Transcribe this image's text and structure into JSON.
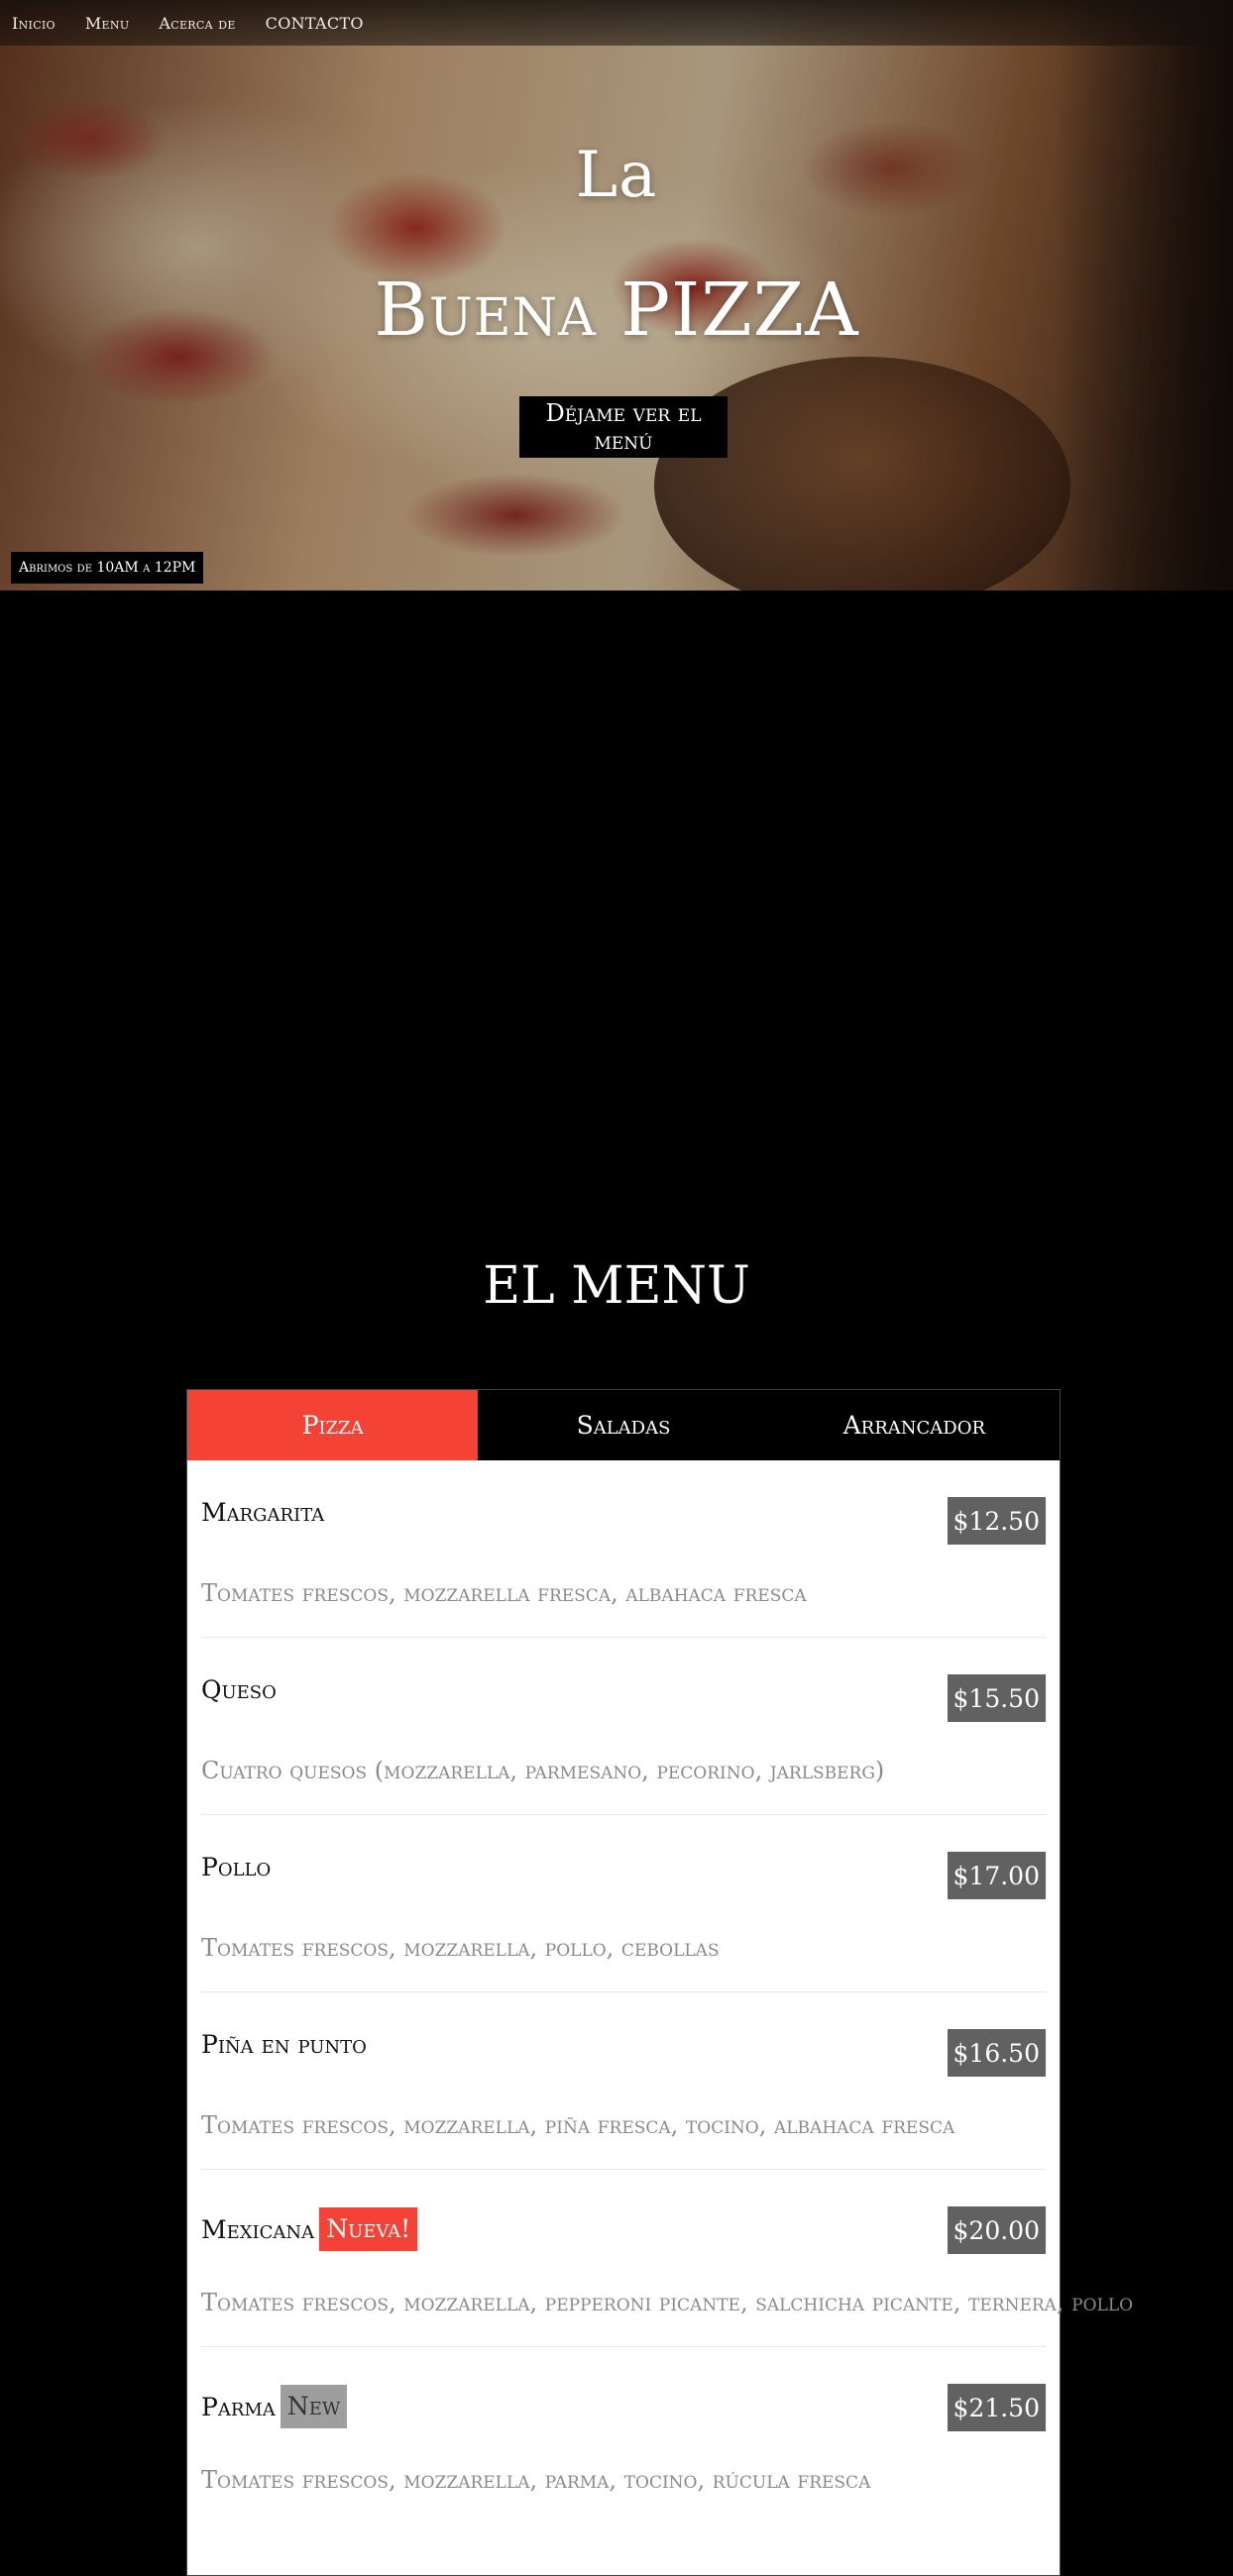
{
  "nav": {
    "items": [
      {
        "label": "Inicio"
      },
      {
        "label": "Menu"
      },
      {
        "label": "Acerca de"
      },
      {
        "label": "CONTACTO"
      }
    ]
  },
  "hero": {
    "title_line1": "La",
    "title_line2": "Buena PIZZA",
    "cta_label": "Déjame ver el menú",
    "hours": "Abrimos de 10AM a 12PM"
  },
  "menu": {
    "heading": "EL MENU",
    "tabs": [
      {
        "label": "Pizza",
        "active": true
      },
      {
        "label": "Saladas",
        "active": false
      },
      {
        "label": "Arrancador",
        "active": false
      }
    ],
    "items": [
      {
        "name": "Margarita",
        "tag": "",
        "price": "$12.50",
        "desc": "Tomates frescos, mozzarella fresca, albahaca fresca"
      },
      {
        "name": "Queso",
        "tag": "",
        "price": "$15.50",
        "desc": "Cuatro quesos (mozzarella, parmesano, pecorino, jarlsberg)"
      },
      {
        "name": "Pollo",
        "tag": "",
        "price": "$17.00",
        "desc": "Tomates frescos, mozzarella, pollo, cebollas"
      },
      {
        "name": "Piña en punto",
        "tag": "",
        "price": "$16.50",
        "desc": "Tomates frescos, mozzarella, piña fresca, tocino, albahaca fresca"
      },
      {
        "name": "Mexicana",
        "tag": "Nueva!",
        "price": "$20.00",
        "desc": "Tomates frescos, mozzarella, pepperoni picante, salchicha picante, ternera, pollo"
      },
      {
        "name": "Parma",
        "tag": "New",
        "price": "$21.50",
        "desc": "Tomates frescos, mozzarella, parma, tocino, rúcula fresca"
      }
    ]
  },
  "colors": {
    "accent": "#f44336",
    "price_bg": "#616161",
    "tag_gray": "#9e9e9e",
    "page_bg": "#000000"
  }
}
